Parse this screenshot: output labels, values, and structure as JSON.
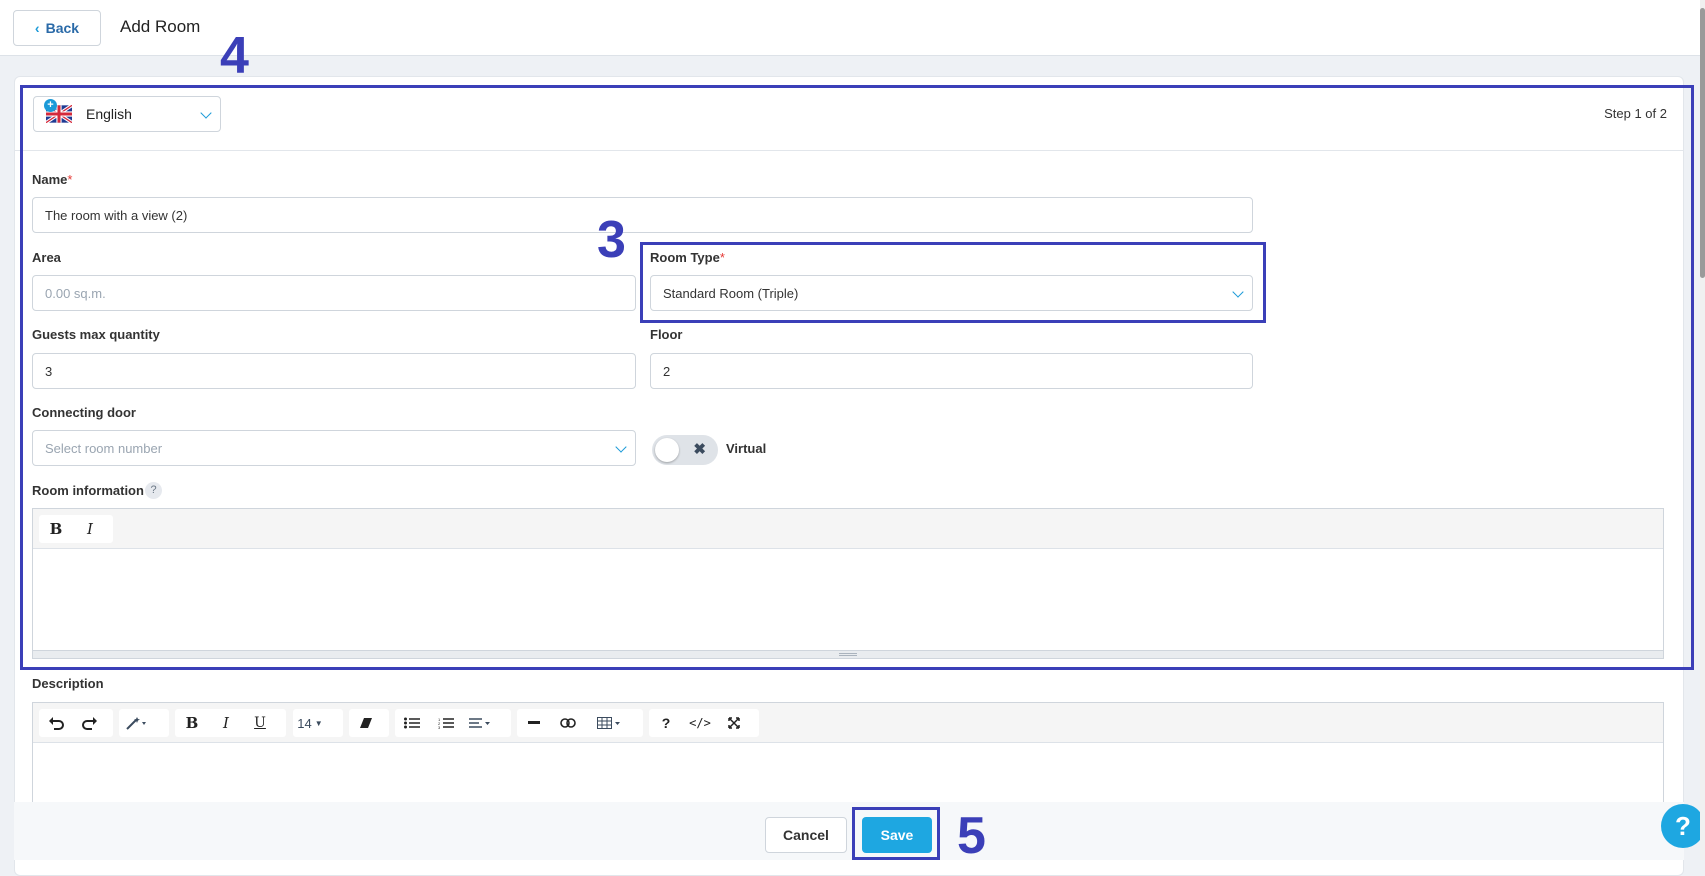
{
  "header": {
    "back_label": "Back",
    "title": "Add Room"
  },
  "language": {
    "selected": "English",
    "step": "Step 1 of 2"
  },
  "form": {
    "name": {
      "label": "Name",
      "required_mark": "*",
      "value": "The room with a view (2)"
    },
    "area": {
      "label": "Area",
      "placeholder": "0.00 sq.m."
    },
    "room_type": {
      "label": "Room Type",
      "required_mark": "*",
      "value": "Standard Room (Triple)"
    },
    "guests_max": {
      "label": "Guests max quantity",
      "value": "3"
    },
    "floor": {
      "label": "Floor",
      "value": "2"
    },
    "connecting_door": {
      "label": "Connecting door",
      "placeholder": "Select room number"
    },
    "virtual": {
      "label": "Virtual",
      "on": false
    },
    "room_information": {
      "label": "Room information",
      "help": "?"
    },
    "description": {
      "label": "Description"
    }
  },
  "room_info_toolbar": [
    "B",
    "I"
  ],
  "description_toolbar": {
    "font_size": "14",
    "help": "?",
    "code": "</>"
  },
  "footer": {
    "cancel_label": "Cancel",
    "save_label": "Save"
  },
  "help_fab": "?",
  "annotations": [
    "3",
    "4",
    "5"
  ],
  "colors": {
    "accent": "#1ea7e1",
    "annotation": "#3b3fb8",
    "required": "#e53935"
  }
}
